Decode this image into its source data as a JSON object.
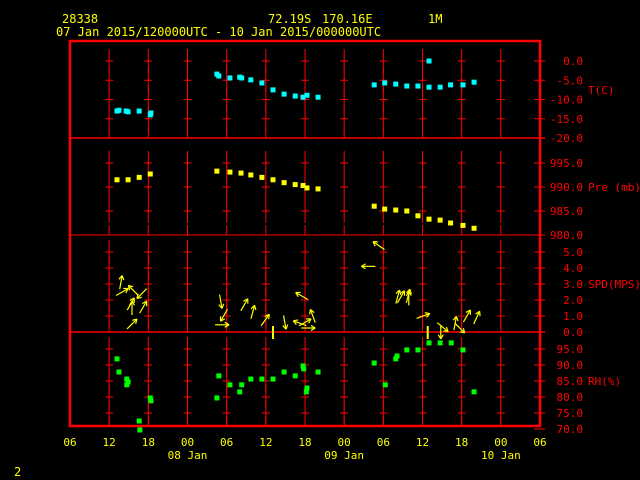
{
  "header": {
    "station": "28338",
    "lat": "72.19S",
    "lon": "170.16E",
    "level": "1M",
    "period": "07 Jan 2015/120000UTC - 10 Jan 2015/000000UTC"
  },
  "page_number": "2",
  "colors": {
    "frame": "#ff0000",
    "text": "#ffff00",
    "temp": "#00ffff",
    "pressure": "#ffff00",
    "wind": "#ffff00",
    "rh": "#00ff00"
  },
  "chart_data": {
    "type": "scatter",
    "x_units": "hours since 07 Jan 2015 06UTC",
    "xlim": [
      0,
      72
    ],
    "x_tick_labels": [
      "06",
      "12",
      "18",
      "00",
      "06",
      "12",
      "18",
      "00",
      "06",
      "12",
      "18",
      "00",
      "06"
    ],
    "date_labels": [
      {
        "label": "08 Jan",
        "hour": 18
      },
      {
        "label": "09 Jan",
        "hour": 42
      },
      {
        "label": "10 Jan",
        "hour": 66
      }
    ],
    "panels": [
      {
        "id": "temp",
        "label": "T(C)",
        "ylim": [
          -20,
          5.2
        ],
        "ticks": [
          {
            "v": 0,
            "t": "0.0"
          },
          {
            "v": -5,
            "t": "-5.0"
          },
          {
            "v": -10,
            "t": "-10.0"
          },
          {
            "v": -15,
            "t": "-15.0"
          },
          {
            "v": -20,
            "t": "-20.0"
          }
        ],
        "points": [
          [
            7.2,
            -13.0
          ],
          [
            7.5,
            -12.8
          ],
          [
            8.6,
            -13.0
          ],
          [
            8.9,
            -13.2
          ],
          [
            10.6,
            -13.0
          ],
          [
            12.3,
            -14.0
          ],
          [
            12.4,
            -13.5
          ],
          [
            22.5,
            -3.4
          ],
          [
            22.8,
            -3.9
          ],
          [
            24.5,
            -4.4
          ],
          [
            26.0,
            -4.2
          ],
          [
            26.3,
            -4.4
          ],
          [
            27.7,
            -4.9
          ],
          [
            29.4,
            -5.7
          ],
          [
            31.1,
            -7.5
          ],
          [
            32.8,
            -8.6
          ],
          [
            34.5,
            -9.1
          ],
          [
            35.7,
            -9.4
          ],
          [
            36.3,
            -8.9
          ],
          [
            38.0,
            -9.4
          ],
          [
            46.6,
            -6.2
          ],
          [
            48.2,
            -5.7
          ],
          [
            49.9,
            -6.0
          ],
          [
            51.6,
            -6.5
          ],
          [
            53.3,
            -6.5
          ],
          [
            55.0,
            0.0
          ],
          [
            55.0,
            -6.8
          ],
          [
            56.7,
            -6.8
          ],
          [
            58.3,
            -6.2
          ],
          [
            60.2,
            -6.2
          ],
          [
            61.9,
            -5.5
          ]
        ]
      },
      {
        "id": "pressure",
        "label": "Pre (mb)",
        "ylim": [
          980,
          1000.2
        ],
        "ticks": [
          {
            "v": 995,
            "t": "995.0"
          },
          {
            "v": 990,
            "t": "990.0"
          },
          {
            "v": 985,
            "t": "985.0"
          },
          {
            "v": 980,
            "t": "980.0"
          }
        ],
        "points": [
          [
            7.2,
            991.5
          ],
          [
            8.9,
            991.5
          ],
          [
            10.6,
            992.0
          ],
          [
            12.3,
            992.7
          ],
          [
            22.5,
            993.3
          ],
          [
            24.5,
            993.1
          ],
          [
            26.2,
            992.9
          ],
          [
            27.7,
            992.5
          ],
          [
            29.4,
            992.0
          ],
          [
            31.1,
            991.5
          ],
          [
            32.8,
            990.9
          ],
          [
            34.5,
            990.5
          ],
          [
            35.7,
            990.3
          ],
          [
            36.3,
            989.8
          ],
          [
            38.0,
            989.6
          ],
          [
            46.6,
            986.0
          ],
          [
            48.2,
            985.4
          ],
          [
            49.9,
            985.2
          ],
          [
            51.6,
            985.0
          ],
          [
            53.3,
            984.0
          ],
          [
            55.0,
            983.3
          ],
          [
            56.7,
            983.1
          ],
          [
            58.3,
            982.5
          ],
          [
            60.2,
            982.0
          ],
          [
            61.9,
            981.4
          ]
        ]
      },
      {
        "id": "wind",
        "label": "SPD(MPS)",
        "ylim": [
          0,
          6.06
        ],
        "ticks": [
          {
            "v": 5,
            "t": "5.0"
          },
          {
            "v": 4,
            "t": "4.0"
          },
          {
            "v": 3,
            "t": "3.0"
          },
          {
            "v": 2,
            "t": "2.0"
          },
          {
            "v": 1,
            "t": "1.0"
          },
          {
            "v": 0,
            "t": "0.0"
          }
        ],
        "arrows_note": "each entry: [hour, speed, arrow direction degrees (0=east, 90=north); null = calm]",
        "arrows": [
          [
            7.8,
            3.1,
            80
          ],
          [
            9.7,
            2.6,
            135
          ],
          [
            8.0,
            2.5,
            30
          ],
          [
            11.0,
            2.4,
            225
          ],
          [
            9.3,
            1.75,
            60
          ],
          [
            9.5,
            1.5,
            90
          ],
          [
            11.2,
            1.55,
            60
          ],
          [
            9.5,
            0.5,
            45
          ],
          [
            23.1,
            1.9,
            280
          ],
          [
            23.6,
            1.05,
            240
          ],
          [
            23.3,
            0.45,
            0
          ],
          [
            26.7,
            1.7,
            60
          ],
          [
            28.0,
            1.25,
            75
          ],
          [
            29.9,
            0.75,
            55
          ],
          [
            31.1,
            0,
            null
          ],
          [
            32.9,
            0.6,
            280
          ],
          [
            35.5,
            2.25,
            150
          ],
          [
            35.2,
            0.55,
            160
          ],
          [
            36.0,
            0.6,
            30
          ],
          [
            37.2,
            1.0,
            110
          ],
          [
            36.5,
            0.25,
            0
          ],
          [
            47.3,
            5.4,
            145
          ],
          [
            45.7,
            4.1,
            180
          ],
          [
            50.2,
            2.2,
            75
          ],
          [
            50.7,
            2.2,
            60
          ],
          [
            51.8,
            2.25,
            75
          ],
          [
            51.9,
            2.1,
            90
          ],
          [
            54.1,
            1.0,
            20
          ],
          [
            54.8,
            0,
            null
          ],
          [
            57.1,
            0.3,
            320
          ],
          [
            56.8,
            0.0,
            270
          ],
          [
            59.0,
            0.55,
            80
          ],
          [
            59.7,
            0.25,
            315
          ],
          [
            60.8,
            1.0,
            60
          ],
          [
            62.3,
            0.9,
            65
          ]
        ]
      },
      {
        "id": "rh",
        "label": "RH(%)",
        "ylim": [
          70,
          100.3
        ],
        "ticks": [
          {
            "v": 95,
            "t": "95.0"
          },
          {
            "v": 90,
            "t": "90.0"
          },
          {
            "v": 85,
            "t": "85.0"
          },
          {
            "v": 80,
            "t": "80.0"
          },
          {
            "v": 75,
            "t": "75.0"
          },
          {
            "v": 70,
            "t": "70.0"
          }
        ],
        "points": [
          [
            7.2,
            91.9
          ],
          [
            7.5,
            87.8
          ],
          [
            8.7,
            85.6
          ],
          [
            8.9,
            84.7
          ],
          [
            8.7,
            83.8
          ],
          [
            12.3,
            79.7
          ],
          [
            12.4,
            78.8
          ],
          [
            10.6,
            72.5
          ],
          [
            10.7,
            69.7
          ],
          [
            22.5,
            79.7
          ],
          [
            22.8,
            86.6
          ],
          [
            24.5,
            83.8
          ],
          [
            26.0,
            81.6
          ],
          [
            26.3,
            83.8
          ],
          [
            27.7,
            85.6
          ],
          [
            29.4,
            85.6
          ],
          [
            31.1,
            85.6
          ],
          [
            32.8,
            87.8
          ],
          [
            34.5,
            86.6
          ],
          [
            35.7,
            89.7
          ],
          [
            35.8,
            88.8
          ],
          [
            36.3,
            82.8
          ],
          [
            36.2,
            81.6
          ],
          [
            38.0,
            87.8
          ],
          [
            46.6,
            90.6
          ],
          [
            48.3,
            83.8
          ],
          [
            49.9,
            91.9
          ],
          [
            50.1,
            92.8
          ],
          [
            51.6,
            94.7
          ],
          [
            53.3,
            94.7
          ],
          [
            55.0,
            96.9
          ],
          [
            56.7,
            96.9
          ],
          [
            58.4,
            96.9
          ],
          [
            60.2,
            94.7
          ],
          [
            61.9,
            81.6
          ]
        ]
      }
    ]
  }
}
